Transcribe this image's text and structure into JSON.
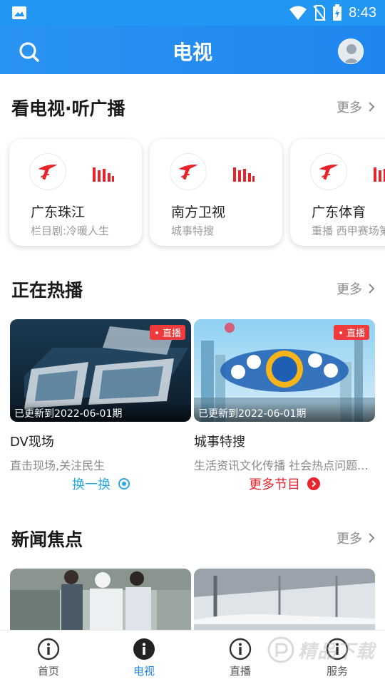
{
  "status_bar": {
    "time": "8:43"
  },
  "app_bar": {
    "title": "电视"
  },
  "sections": {
    "tv_radio": {
      "title": "看电视·听广播",
      "more": "更多"
    },
    "hot": {
      "title": "正在热播",
      "more": "更多"
    },
    "news": {
      "title": "新闻焦点",
      "more": "更多"
    }
  },
  "channels": [
    {
      "name": "广东珠江",
      "sub": "栏目剧:冷暖人生"
    },
    {
      "name": "南方卫视",
      "sub": "城事特搜"
    },
    {
      "name": "广东体育",
      "sub": "重播 西甲赛场第"
    }
  ],
  "shows": [
    {
      "title": "DV现场",
      "desc": "直击现场,关注民生",
      "badge": "• 直播",
      "updated": "已更新到2022-06-01期"
    },
    {
      "title": "城事特搜",
      "desc": "生活资讯文化传播 社会热点问题...",
      "badge": "• 直播",
      "updated": "已更新到2022-06-01期"
    }
  ],
  "actions": {
    "refresh": "换一换",
    "more_programs": "更多节目"
  },
  "bottom_nav": [
    {
      "label": "首页"
    },
    {
      "label": "电视"
    },
    {
      "label": "直播"
    },
    {
      "label": "服务"
    }
  ],
  "colors": {
    "primary": "#1f86ef",
    "accent_red": "#e8232a",
    "refresh_blue": "#2ba8e6"
  },
  "watermark": "精品下载"
}
